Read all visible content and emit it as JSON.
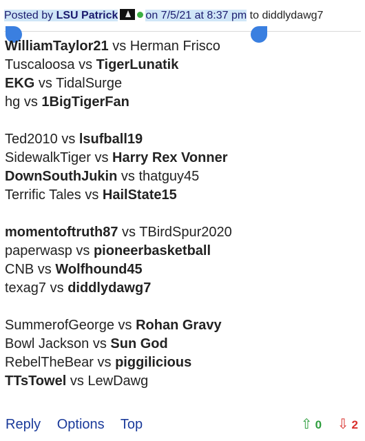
{
  "post": {
    "posted_by_label": "Posted by",
    "author": "LSU Patrick",
    "on_label": "on",
    "date": "7/5/21",
    "at_label": "at",
    "time": "8:37 pm",
    "to_label": "to",
    "recipient": "diddlydawg7",
    "status_color": "#3cb043"
  },
  "matchups": [
    {
      "left": "WilliamTaylor21",
      "vs": "vs",
      "right": "Herman Frisco",
      "bold": "left"
    },
    {
      "left": "Tuscaloosa",
      "vs": "vs",
      "right": "TigerLunatik",
      "bold": "right"
    },
    {
      "left": "EKG",
      "vs": "vs",
      "right": "TidalSurge",
      "bold": "left"
    },
    {
      "left": "hg",
      "vs": "vs",
      "right": "1BigTigerFan",
      "bold": "right"
    },
    null,
    {
      "left": "Ted2010",
      "vs": "vs",
      "right": "lsufball19",
      "bold": "right"
    },
    {
      "left": "SidewalkTiger",
      "vs": "vs",
      "right": "Harry Rex Vonner",
      "bold": "right"
    },
    {
      "left": "DownSouthJukin",
      "vs": "vs",
      "right": "thatguy45",
      "bold": "left"
    },
    {
      "left": "Terrific Tales",
      "vs": "vs",
      "right": "HailState15",
      "bold": "right"
    },
    null,
    {
      "left": "momentoftruth87",
      "vs": "vs",
      "right": "TBirdSpur2020",
      "bold": "left"
    },
    {
      "left": "paperwasp",
      "vs": "vs",
      "right": "pioneerbasketball",
      "bold": "right"
    },
    {
      "left": "CNB",
      "vs": "vs",
      "right": "Wolfhound45",
      "bold": "right"
    },
    {
      "left": "texag7",
      "vs": "vs",
      "right": "diddlydawg7",
      "bold": "right"
    },
    null,
    {
      "left": "SummerofGeorge",
      "vs": "vs",
      "right": "Rohan Gravy",
      "bold": "right"
    },
    {
      "left": "Bowl Jackson",
      "vs": "vs",
      "right": "Sun God",
      "bold": "right"
    },
    {
      "left": "RebelTheBear",
      "vs": "vs",
      "right": "piggilicious",
      "bold": "right"
    },
    {
      "left": "TTsTowel",
      "vs": "vs",
      "right": "LewDawg",
      "bold": "left"
    }
  ],
  "footer": {
    "reply_label": "Reply",
    "options_label": "Options",
    "top_label": "Top",
    "upvotes": "0",
    "downvotes": "2",
    "up_icon": "up-arrow-icon",
    "down_icon": "down-arrow-icon"
  },
  "colors": {
    "selection_highlight": "#cfe6f7",
    "selection_handle": "#3a7fe0",
    "link": "#1a3a9a",
    "upvote": "#2e9e3e",
    "downvote": "#d9302c"
  }
}
